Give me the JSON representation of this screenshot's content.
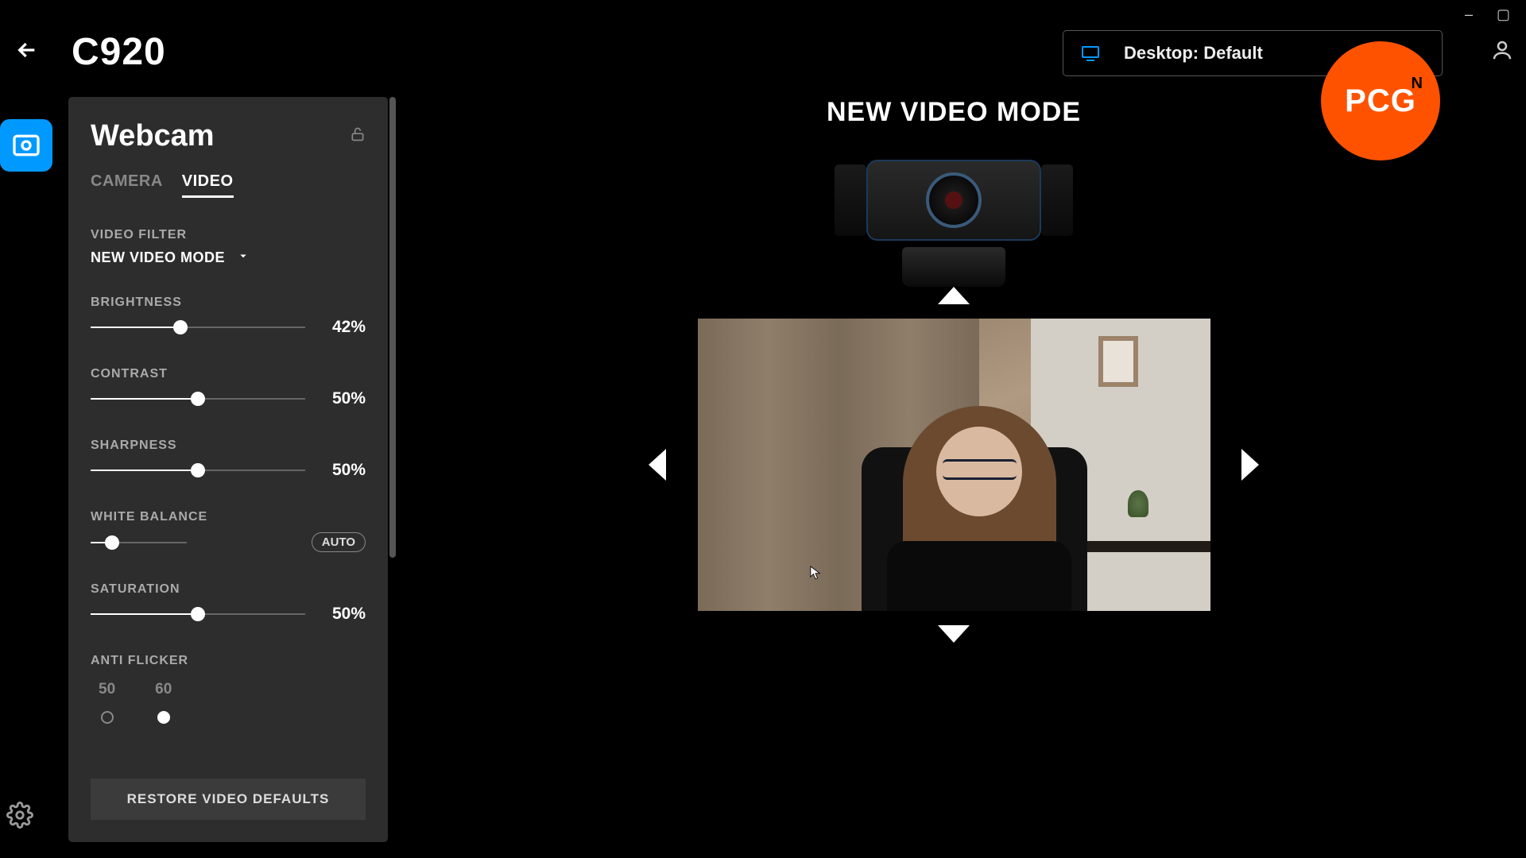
{
  "window": {
    "minimize": "–",
    "maximize": "▢"
  },
  "header": {
    "device_name": "C920",
    "desktop_label": "Desktop: Default"
  },
  "brand": {
    "main": "PCG",
    "sup": "N"
  },
  "sidebar": {
    "title": "Webcam",
    "tabs": {
      "camera": "CAMERA",
      "video": "VIDEO",
      "active": "video"
    },
    "video_filter": {
      "label": "VIDEO FILTER",
      "value": "NEW VIDEO MODE"
    },
    "sliders": {
      "brightness": {
        "label": "BRIGHTNESS",
        "value": 42,
        "display": "42%"
      },
      "contrast": {
        "label": "CONTRAST",
        "value": 50,
        "display": "50%"
      },
      "sharpness": {
        "label": "SHARPNESS",
        "value": 50,
        "display": "50%"
      },
      "white_balance": {
        "label": "WHITE BALANCE",
        "value": 22,
        "auto_label": "AUTO"
      },
      "saturation": {
        "label": "SATURATION",
        "value": 50,
        "display": "50%"
      }
    },
    "anti_flicker": {
      "label": "ANTI FLICKER",
      "opt1": "50",
      "opt2": "60",
      "selected": "60"
    },
    "restore_label": "RESTORE VIDEO DEFAULTS"
  },
  "main": {
    "mode_title": "NEW VIDEO MODE"
  }
}
